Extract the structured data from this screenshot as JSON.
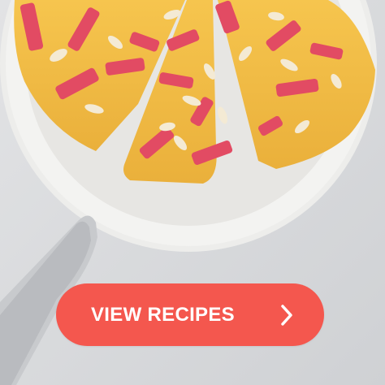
{
  "promo": {
    "image_subject": "rhubarb-almond-cake-photo",
    "cta": {
      "label": "VIEW RECIPES",
      "icon": "chevron-right-icon",
      "background_color": "#f4574e",
      "text_color": "#ffffff"
    }
  }
}
